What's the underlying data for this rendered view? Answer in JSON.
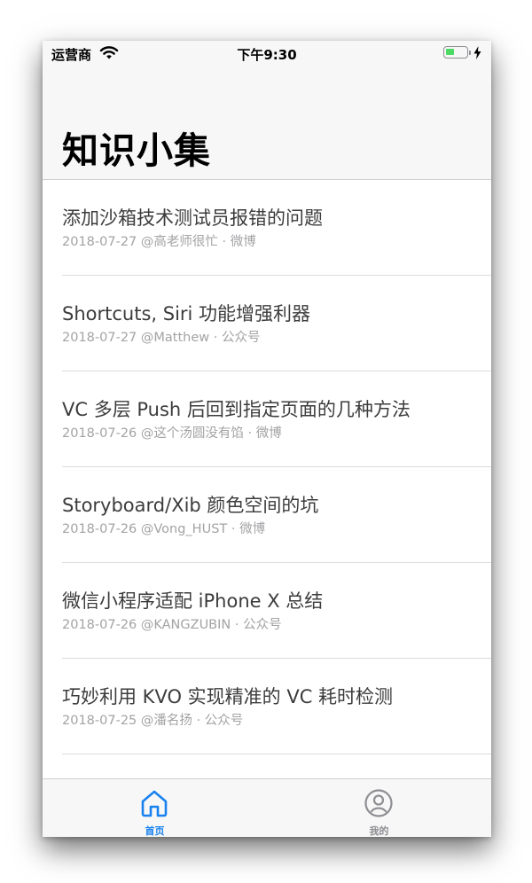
{
  "status_bar": {
    "carrier": "运营商",
    "time": "下午9:30",
    "battery_level": 0.45,
    "colors": {
      "battery_fill": "#4cd964"
    },
    "icons": [
      "wifi-icon",
      "battery-icon",
      "charging-bolt-icon"
    ]
  },
  "nav": {
    "title": "知识小集"
  },
  "articles": [
    {
      "title": "添加沙箱技术测试员报错的问题",
      "meta": "2018-07-27 @高老师很忙 · 微博"
    },
    {
      "title": "Shortcuts, Siri 功能增强利器",
      "meta": "2018-07-27 @Matthew · 公众号"
    },
    {
      "title": "VC 多层 Push 后回到指定页面的几种方法",
      "meta": "2018-07-26 @这个汤圆没有馅 · 微博"
    },
    {
      "title": "Storyboard/Xib 颜色空间的坑",
      "meta": "2018-07-26 @Vong_HUST · 微博"
    },
    {
      "title": "微信小程序适配 iPhone X 总结",
      "meta": "2018-07-26 @KANGZUBIN · 公众号"
    },
    {
      "title": "巧妙利用 KVO 实现精准的 VC 耗时检测",
      "meta": "2018-07-25 @潘名扬 · 公众号"
    }
  ],
  "tab_bar": {
    "home": {
      "label": "首页",
      "icon": "home-icon",
      "selected": true
    },
    "mine": {
      "label": "我的",
      "icon": "user-icon",
      "selected": false
    },
    "colors": {
      "selected": "#1a82f0",
      "unselected": "#8e8e93"
    }
  }
}
